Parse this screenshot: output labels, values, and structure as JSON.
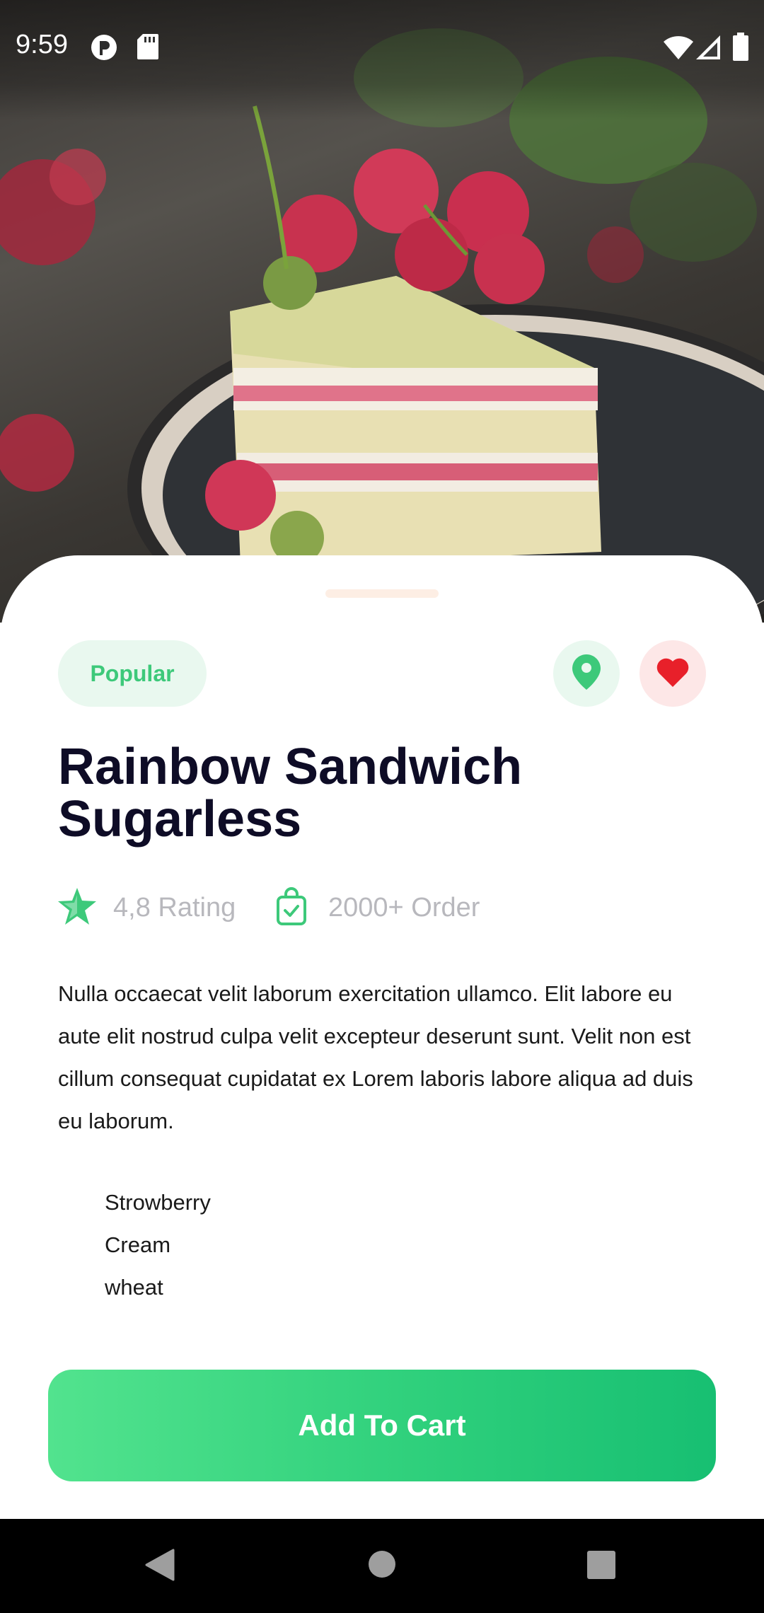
{
  "status_bar": {
    "time": "9:59",
    "left_icons": [
      "privacy-dot-icon",
      "sd-card-icon"
    ],
    "right_icons": [
      "wifi-icon",
      "cellular-signal-icon",
      "battery-icon"
    ]
  },
  "hero": {
    "image": "cake-slice-with-raspberries-photo"
  },
  "product": {
    "tag": "Popular",
    "title": "Rainbow Sandwich Sugarless",
    "rating_text": "4,8 Rating",
    "orders_text": "2000+ Order",
    "description": "Nulla occaecat velit laborum exercitation ullamco. Elit labore eu aute elit nostrud culpa velit excepteur deserunt sunt. Velit non est cillum consequat cupidatat ex Lorem laboris labore aliqua ad duis eu laborum.",
    "ingredients": [
      "Strowberry",
      "Cream",
      "wheat"
    ],
    "description_more": "Nulla occaecat velit laborum exercitation ullamco. Elit"
  },
  "actions": {
    "location_icon": "location-pin-icon",
    "favorite_icon": "heart-icon",
    "add_to_cart_label": "Add To Cart"
  },
  "colors": {
    "accent_green": "#3dc97a",
    "favorite_red": "#e8202a",
    "title_dark": "#0e0c26"
  },
  "nav_bar": {
    "buttons": [
      "back-triangle-icon",
      "home-circle-icon",
      "recents-square-icon"
    ]
  }
}
